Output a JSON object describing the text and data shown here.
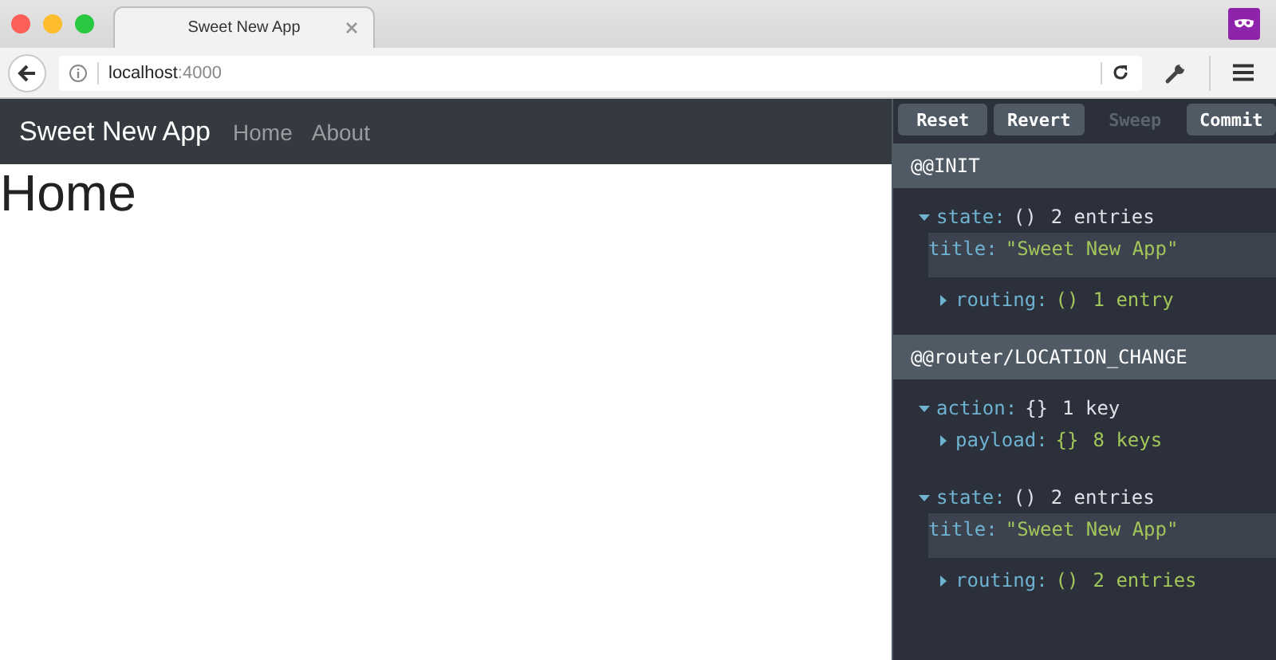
{
  "browser": {
    "tab_title": "Sweet New App",
    "url_host": "localhost",
    "url_port": ":4000"
  },
  "app": {
    "brand": "Sweet New App",
    "nav": [
      {
        "label": "Home"
      },
      {
        "label": "About"
      }
    ],
    "heading": "Home"
  },
  "monitor": {
    "buttons": [
      {
        "label": "Reset",
        "disabled": false
      },
      {
        "label": "Revert",
        "disabled": false
      },
      {
        "label": "Sweep",
        "disabled": true
      },
      {
        "label": "Commit",
        "disabled": false
      }
    ],
    "actions": [
      {
        "name": "@@INIT",
        "tree": [
          {
            "kind": "node",
            "key": "state:",
            "glyph": "()",
            "summary": "2 entries",
            "expanded": true,
            "children": [
              {
                "kind": "leaf",
                "key": "title:",
                "value": "\"Sweet New App\""
              },
              {
                "kind": "node",
                "key": "routing:",
                "glyph": "()",
                "summary": "1 entry",
                "expanded": false
              }
            ]
          }
        ]
      },
      {
        "name": "@@router/LOCATION_CHANGE",
        "tree": [
          {
            "kind": "node",
            "key": "action:",
            "glyph": "{}",
            "summary": "1 key",
            "expanded": true,
            "children": [
              {
                "kind": "node",
                "key": "payload:",
                "glyph": "{}",
                "summary": "8 keys",
                "expanded": false
              }
            ]
          },
          {
            "kind": "node",
            "key": "state:",
            "glyph": "()",
            "summary": "2 entries",
            "expanded": true,
            "children": [
              {
                "kind": "leaf",
                "key": "title:",
                "value": "\"Sweet New App\""
              },
              {
                "kind": "node",
                "key": "routing:",
                "glyph": "()",
                "summary": "2 entries",
                "expanded": false
              }
            ]
          }
        ]
      }
    ]
  }
}
